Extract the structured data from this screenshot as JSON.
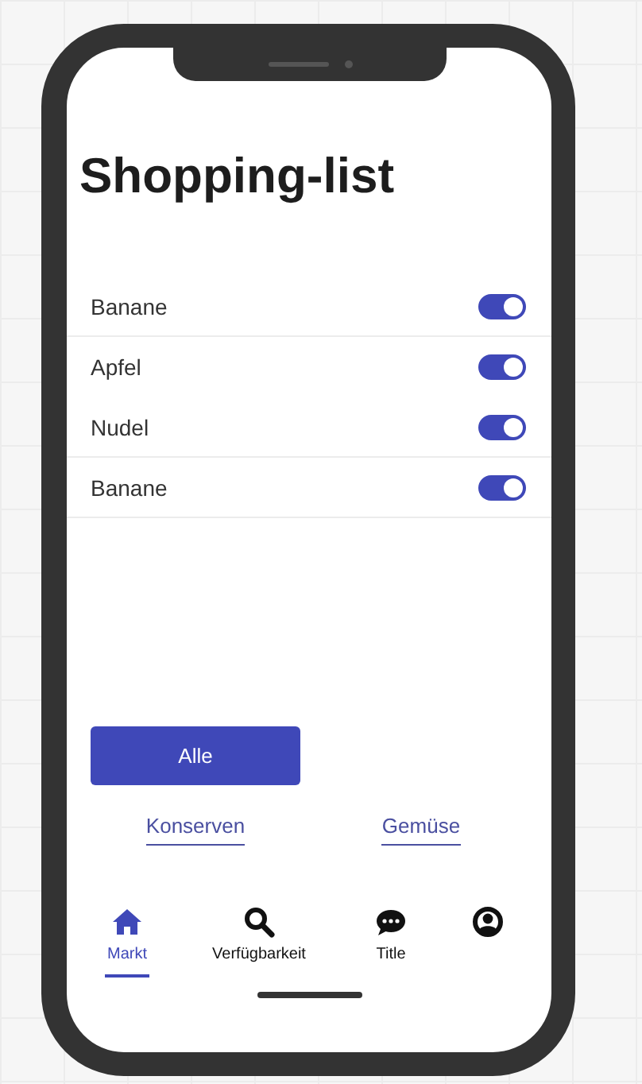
{
  "title": "Shopping-list",
  "items": [
    {
      "label": "Banane",
      "on": true,
      "divider": true
    },
    {
      "label": "Apfel",
      "on": true,
      "divider": false
    },
    {
      "label": "Nudel",
      "on": true,
      "divider": true
    },
    {
      "label": "Banane",
      "on": true,
      "divider": true
    }
  ],
  "primary_button": "Alle",
  "links": [
    "Konserven",
    "Gemüse"
  ],
  "nav": [
    {
      "kind": "home",
      "label": "Markt",
      "selected": true
    },
    {
      "kind": "search",
      "label": "Verfügbarkeit",
      "selected": false
    },
    {
      "kind": "chat",
      "label": "Title",
      "selected": false
    },
    {
      "kind": "profile",
      "selected": false
    }
  ]
}
